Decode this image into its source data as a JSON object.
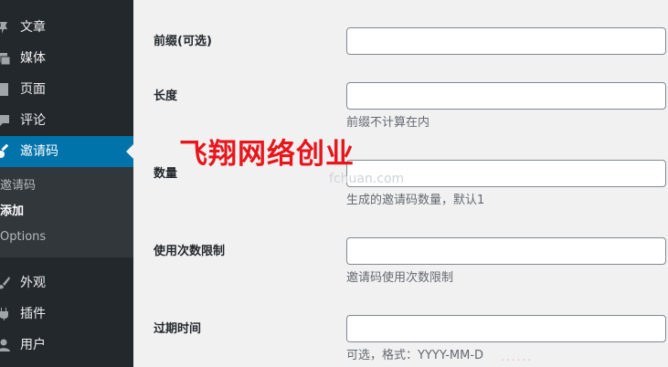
{
  "sidebar": {
    "items": [
      {
        "label": "文章",
        "icon": "pin-icon"
      },
      {
        "label": "媒体",
        "icon": "media-icon"
      },
      {
        "label": "页面",
        "icon": "page-icon"
      },
      {
        "label": "评论",
        "icon": "comment-icon"
      },
      {
        "label": "邀请码",
        "icon": "key-icon"
      },
      {
        "label": "外观",
        "icon": "brush-icon"
      },
      {
        "label": "插件",
        "icon": "plugin-icon"
      },
      {
        "label": "用户",
        "icon": "user-icon"
      }
    ],
    "submenu": [
      {
        "label": "邀请码"
      },
      {
        "label": "添加"
      },
      {
        "label": "Options"
      }
    ],
    "accent": "#0073aa"
  },
  "form": {
    "prefix": {
      "label": "前缀(可选)",
      "value": ""
    },
    "length": {
      "label": "长度",
      "value": "",
      "desc": "前缀不计算在内"
    },
    "count": {
      "label": "数量",
      "value": "",
      "desc": "生成的邀请码数量，默认1"
    },
    "limit": {
      "label": "使用次数限制",
      "value": "",
      "desc": "邀请码使用次数限制"
    },
    "expire": {
      "label": "过期时间",
      "value": "",
      "desc": "可选，格式：YYYY-MM-D"
    }
  },
  "overlay": {
    "watermark": "飞翔网络创业",
    "faint_text": "fchuan.com",
    "dots": "......",
    "color": "#e8151b"
  }
}
